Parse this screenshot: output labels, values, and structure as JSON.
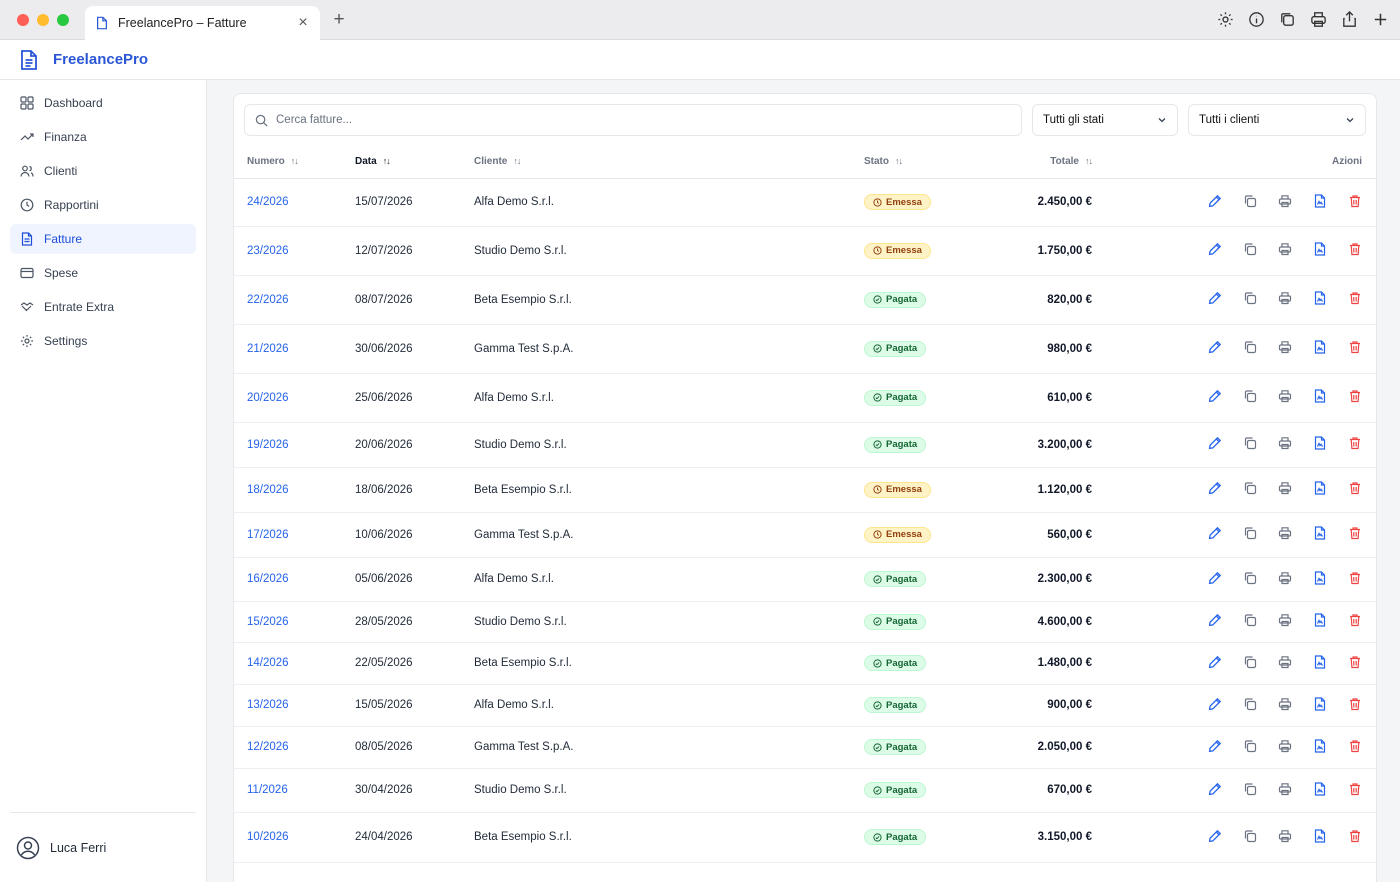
{
  "browser": {
    "tab_title": "FreelancePro – Fatture"
  },
  "app": {
    "brand": "FreelancePro"
  },
  "sidebar": {
    "items": [
      {
        "label": "Dashboard",
        "icon": "grid-icon",
        "active": false
      },
      {
        "label": "Finanza",
        "icon": "trend-icon",
        "active": false
      },
      {
        "label": "Clienti",
        "icon": "users-icon",
        "active": false
      },
      {
        "label": "Rapportini",
        "icon": "clock-icon",
        "active": false
      },
      {
        "label": "Fatture",
        "icon": "document-icon",
        "active": true
      },
      {
        "label": "Spese",
        "icon": "card-icon",
        "active": false
      },
      {
        "label": "Entrate Extra",
        "icon": "handshake-icon",
        "active": false
      },
      {
        "label": "Settings",
        "icon": "gear-icon",
        "active": false
      }
    ],
    "user": "Luca Ferri"
  },
  "filters": {
    "search_placeholder": "Cerca fatture...",
    "status_select": "Tutti gli stati",
    "client_select": "Tutti i clienti"
  },
  "table": {
    "columns": {
      "numero": "Numero",
      "data": "Data",
      "cliente": "Cliente",
      "stato": "Stato",
      "totale": "Totale",
      "azioni": "Azioni"
    },
    "rows": [
      {
        "numero": "24/2026",
        "data": "15/07/2026",
        "cliente": "Alfa Demo S.r.l.",
        "stato": "Emessa",
        "totale": "2.450,00 €"
      },
      {
        "numero": "23/2026",
        "data": "12/07/2026",
        "cliente": "Studio Demo S.r.l.",
        "stato": "Emessa",
        "totale": "1.750,00 €"
      },
      {
        "numero": "22/2026",
        "data": "08/07/2026",
        "cliente": "Beta Esempio S.r.l.",
        "stato": "Pagata",
        "totale": "820,00 €"
      },
      {
        "numero": "21/2026",
        "data": "30/06/2026",
        "cliente": "Gamma Test S.p.A.",
        "stato": "Pagata",
        "totale": "980,00 €"
      },
      {
        "numero": "20/2026",
        "data": "25/06/2026",
        "cliente": "Alfa Demo S.r.l.",
        "stato": "Pagata",
        "totale": "610,00 €"
      },
      {
        "numero": "19/2026",
        "data": "20/06/2026",
        "cliente": "Studio Demo S.r.l.",
        "stato": "Pagata",
        "totale": "3.200,00 €"
      },
      {
        "numero": "18/2026",
        "data": "18/06/2026",
        "cliente": "Beta Esempio S.r.l.",
        "stato": "Emessa",
        "totale": "1.120,00 €"
      },
      {
        "numero": "17/2026",
        "data": "10/06/2026",
        "cliente": "Gamma Test S.p.A.",
        "stato": "Emessa",
        "totale": "560,00 €"
      },
      {
        "numero": "16/2026",
        "data": "05/06/2026",
        "cliente": "Alfa Demo S.r.l.",
        "stato": "Pagata",
        "totale": "2.300,00 €"
      },
      {
        "numero": "15/2026",
        "data": "28/05/2026",
        "cliente": "Studio Demo S.r.l.",
        "stato": "Pagata",
        "totale": "4.600,00 €"
      },
      {
        "numero": "14/2026",
        "data": "22/05/2026",
        "cliente": "Beta Esempio S.r.l.",
        "stato": "Pagata",
        "totale": "1.480,00 €"
      },
      {
        "numero": "13/2026",
        "data": "15/05/2026",
        "cliente": "Alfa Demo S.r.l.",
        "stato": "Pagata",
        "totale": "900,00 €"
      },
      {
        "numero": "12/2026",
        "data": "08/05/2026",
        "cliente": "Gamma Test S.p.A.",
        "stato": "Pagata",
        "totale": "2.050,00 €"
      },
      {
        "numero": "11/2026",
        "data": "30/04/2026",
        "cliente": "Studio Demo S.r.l.",
        "stato": "Pagata",
        "totale": "670,00 €"
      },
      {
        "numero": "10/2026",
        "data": "24/04/2026",
        "cliente": "Beta Esempio S.r.l.",
        "stato": "Pagata",
        "totale": "3.150,00 €"
      }
    ]
  },
  "colors": {
    "accent": "#2563eb",
    "emessa_bg": "#fef3c7",
    "pagata_bg": "#dcfce7",
    "delete": "#ef4444"
  }
}
